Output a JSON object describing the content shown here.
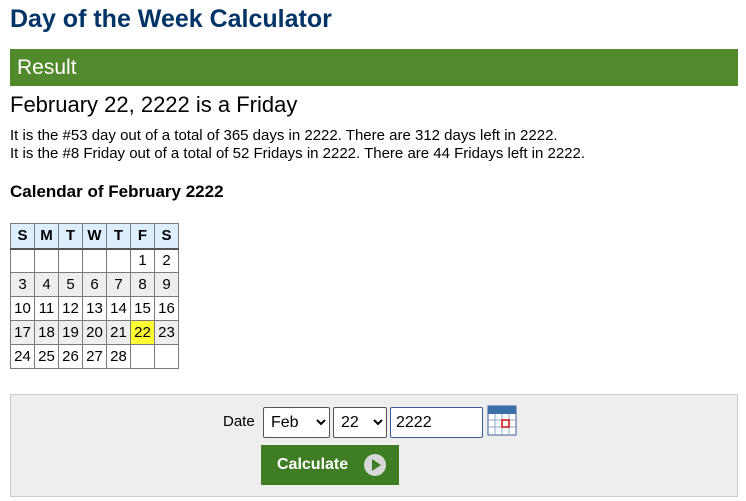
{
  "page": {
    "title": "Day of the Week Calculator"
  },
  "result": {
    "bar_label": "Result",
    "headline": "February 22, 2222 is a Friday",
    "line1": "It is the #53 day out of a total of 365 days in 2222. There are 312 days left in 2222.",
    "line2": "It is the #8 Friday out of a total of 52 Fridays in 2222. There are 44 Fridays left in 2222."
  },
  "calendar": {
    "heading": "Calendar of February 2222",
    "weekdays": [
      "S",
      "M",
      "T",
      "W",
      "T",
      "F",
      "S"
    ],
    "highlight_day": "22",
    "highlight_color": "#ffff33",
    "rows": [
      [
        "",
        "",
        "",
        "",
        "",
        "1",
        "2"
      ],
      [
        "3",
        "4",
        "5",
        "6",
        "7",
        "8",
        "9"
      ],
      [
        "10",
        "11",
        "12",
        "13",
        "14",
        "15",
        "16"
      ],
      [
        "17",
        "18",
        "19",
        "20",
        "21",
        "22",
        "23"
      ],
      [
        "24",
        "25",
        "26",
        "27",
        "28",
        "",
        ""
      ]
    ]
  },
  "form": {
    "date_label": "Date",
    "month_value": "Feb",
    "day_value": "22",
    "year_value": "2222",
    "calculate_label": "Calculate"
  },
  "colors": {
    "title": "#003366",
    "result_bar": "#518a2c",
    "button": "#3f7d24"
  }
}
